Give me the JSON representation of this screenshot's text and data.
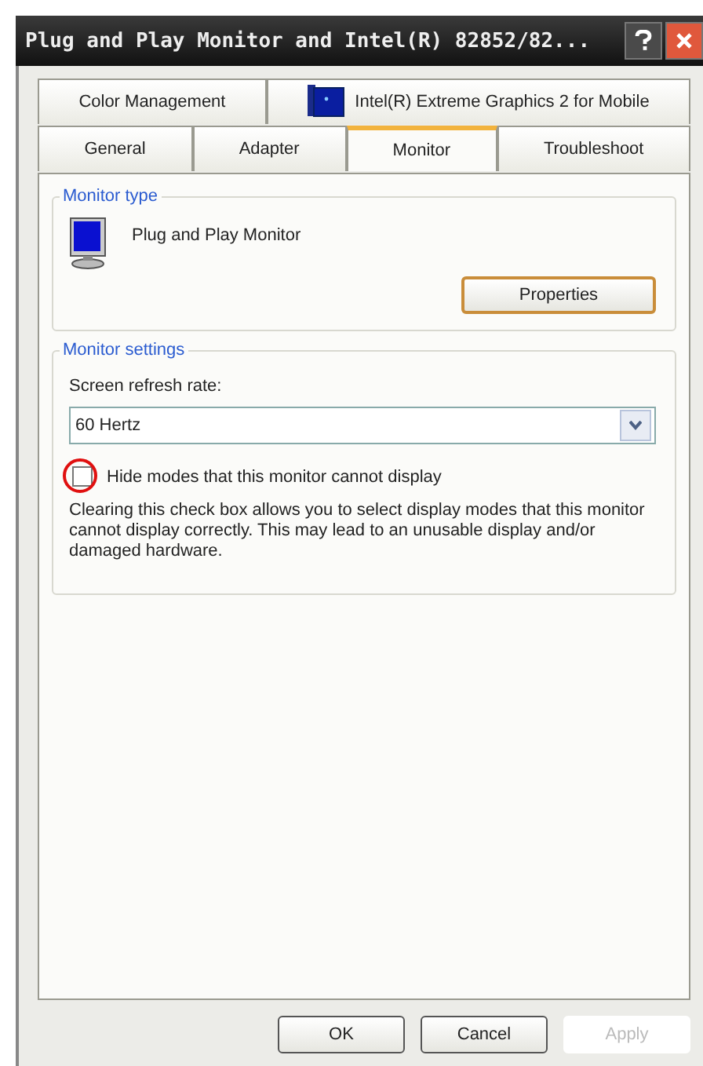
{
  "window": {
    "title": "Plug and Play Monitor and Intel(R) 82852/82..."
  },
  "tab_rows": [
    {
      "tabs": [
        {
          "label": "Color Management",
          "selected": false,
          "kind": "plain"
        },
        {
          "label": "Intel(R) Extreme Graphics 2 for Mobile",
          "selected": false,
          "kind": "icon"
        }
      ]
    },
    {
      "tabs": [
        {
          "label": "General",
          "selected": false,
          "kind": "plain"
        },
        {
          "label": "Adapter",
          "selected": false,
          "kind": "plain"
        },
        {
          "label": "Monitor",
          "selected": true,
          "kind": "plain"
        },
        {
          "label": "Troubleshoot",
          "selected": false,
          "kind": "plain"
        }
      ]
    }
  ],
  "monitor_type": {
    "title": "Monitor type",
    "name": "Plug and Play Monitor",
    "button": "Properties"
  },
  "monitor_settings": {
    "title": "Monitor settings",
    "refresh_label": "Screen refresh rate:",
    "refresh_value": "60 Hertz",
    "hide_modes": {
      "label": "Hide modes that this monitor cannot display",
      "checked": false,
      "annotated": true
    },
    "note": "Clearing this check box allows you to select display modes that this monitor cannot display correctly. This may lead to an unusable display and/or damaged hardware."
  },
  "buttons": [
    {
      "label": "OK",
      "disabled": false
    },
    {
      "label": "Cancel",
      "disabled": false
    },
    {
      "label": "Apply",
      "disabled": true
    }
  ]
}
